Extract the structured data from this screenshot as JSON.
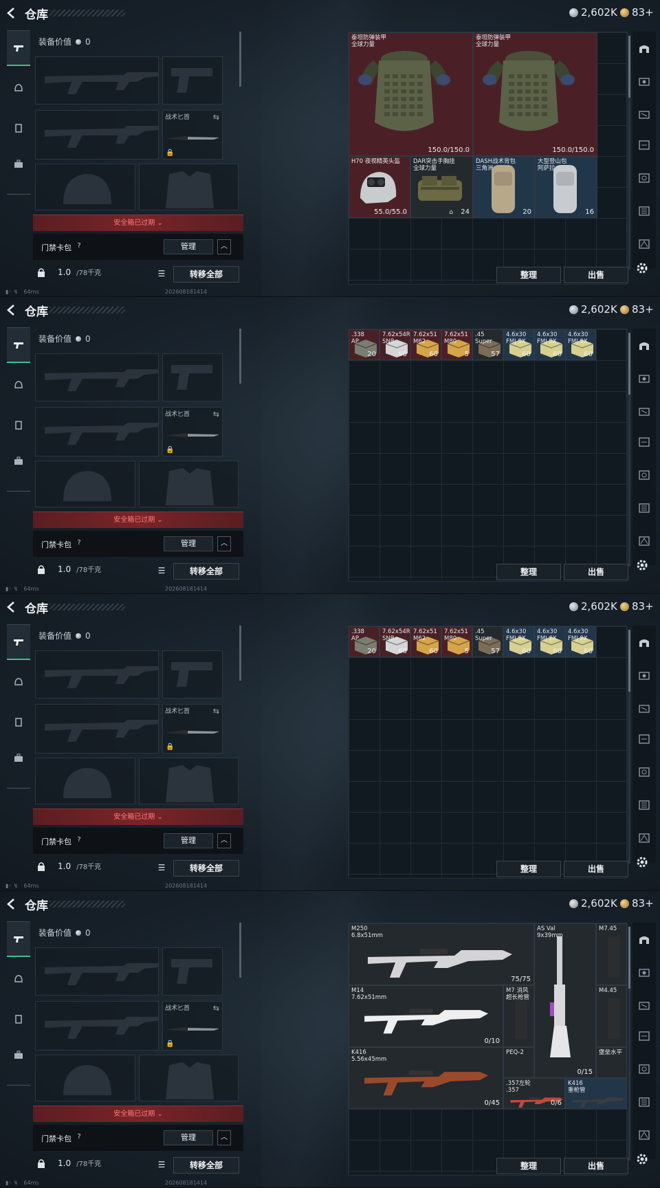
{
  "topbar": {
    "title": "仓库",
    "silver": "2,602K",
    "gold": "83+"
  },
  "equip": {
    "value_label": "装备价值",
    "value": "0",
    "knife_label": "战术匕首",
    "expired": "安全箱已过期 ⌄",
    "card_label": "门禁卡包",
    "manage": "管理",
    "weight": "1.0",
    "weight_max": "/78千克",
    "transfer_all": "转移全部"
  },
  "footer": {
    "ping": "64ms",
    "timestamp": "202608181414"
  },
  "stash_buttons": {
    "sort": "整理",
    "sell": "出售"
  },
  "panels": [
    {
      "items": [
        {
          "name": "泰坦防弹装甲\n全球力量",
          "qty": "150.0/150.0",
          "color": "red",
          "art": "armor"
        },
        {
          "name": "泰坦防弹装甲\n全球力量",
          "qty": "150.0/150.0",
          "color": "red",
          "art": "armor"
        },
        {
          "name": "H70 夜视精英头盔",
          "qty": "55.0/55.0",
          "color": "red",
          "art": "helmet"
        },
        {
          "name": "DAR突击手胸挂\n全球力量",
          "qty": "24",
          "color": "dark",
          "art": "rig"
        },
        {
          "name": "DASH战术背包\n三角洲",
          "qty": "20",
          "color": "blue",
          "art": "pack1"
        },
        {
          "name": "大型登山包\n阿萨拉",
          "qty": "16",
          "color": "blue",
          "art": "pack2"
        }
      ]
    },
    {
      "items": [
        {
          "name": ".338\nAP",
          "qty": "20",
          "color": "red"
        },
        {
          "name": "7.62x54R\nSNB",
          "qty": "60",
          "color": "red"
        },
        {
          "name": "7.62x51\nM62",
          "qty": "60",
          "color": "red"
        },
        {
          "name": "7.62x51\nM80",
          "qty": "5",
          "color": "red"
        },
        {
          "name": ".45\nSuper",
          "qty": "57",
          "color": "dark"
        },
        {
          "name": "4.6x30\nFMJ SX",
          "qty": "60",
          "color": "blue"
        },
        {
          "name": "4.6x30\nFMJ SX",
          "qty": "60",
          "color": "blue"
        },
        {
          "name": "4.6x30\nFMJ SX",
          "qty": "60",
          "color": "blue"
        }
      ]
    },
    {
      "items": [
        {
          "name": ".338\nAP",
          "qty": "20",
          "color": "red"
        },
        {
          "name": "7.62x54R\nSNB",
          "qty": "60",
          "color": "red"
        },
        {
          "name": "7.62x51\nM62",
          "qty": "60",
          "color": "red"
        },
        {
          "name": "7.62x51\nM80",
          "qty": "5",
          "color": "red"
        },
        {
          "name": ".45\nSuper",
          "qty": "57",
          "color": "dark"
        },
        {
          "name": "4.6x30\nFMJ SX",
          "qty": "60",
          "color": "blue"
        },
        {
          "name": "4.6x30\nFMJ SX",
          "qty": "60",
          "color": "blue"
        },
        {
          "name": "4.6x30\nFMJ SX",
          "qty": "60",
          "color": "blue"
        }
      ]
    },
    {
      "items": [
        {
          "name": "M250\n6.8x51mm",
          "qty": "75/75",
          "color": "dark"
        },
        {
          "name": "AS Val\n9x39mm",
          "qty": "0/15",
          "color": "dark"
        },
        {
          "name": "M7.45",
          "qty": "",
          "color": "dark"
        },
        {
          "name": "M14\n7.62x51mm",
          "qty": "0/10",
          "color": "dark"
        },
        {
          "name": "M7 消风\n超长枪管",
          "qty": "",
          "color": "dark"
        },
        {
          "name": "M4.45",
          "qty": "",
          "color": "dark"
        },
        {
          "name": "K416\n5.56x45mm",
          "qty": "0/45",
          "color": "dark"
        },
        {
          "name": "PEQ-2",
          "qty": "",
          "color": "dark"
        },
        {
          "name": "堡垒水平",
          "qty": "",
          "color": "dark"
        },
        {
          "name": ".357左轮\n.357",
          "qty": "0/6",
          "color": "dark"
        },
        {
          "name": "K416\n重枪管",
          "qty": "",
          "color": "blue"
        }
      ]
    }
  ],
  "colors": {
    "accent": "#3fbf8f",
    "red_item": "#4a2026",
    "blue_item": "#22364a",
    "expired_text": "#ff7a7a"
  }
}
